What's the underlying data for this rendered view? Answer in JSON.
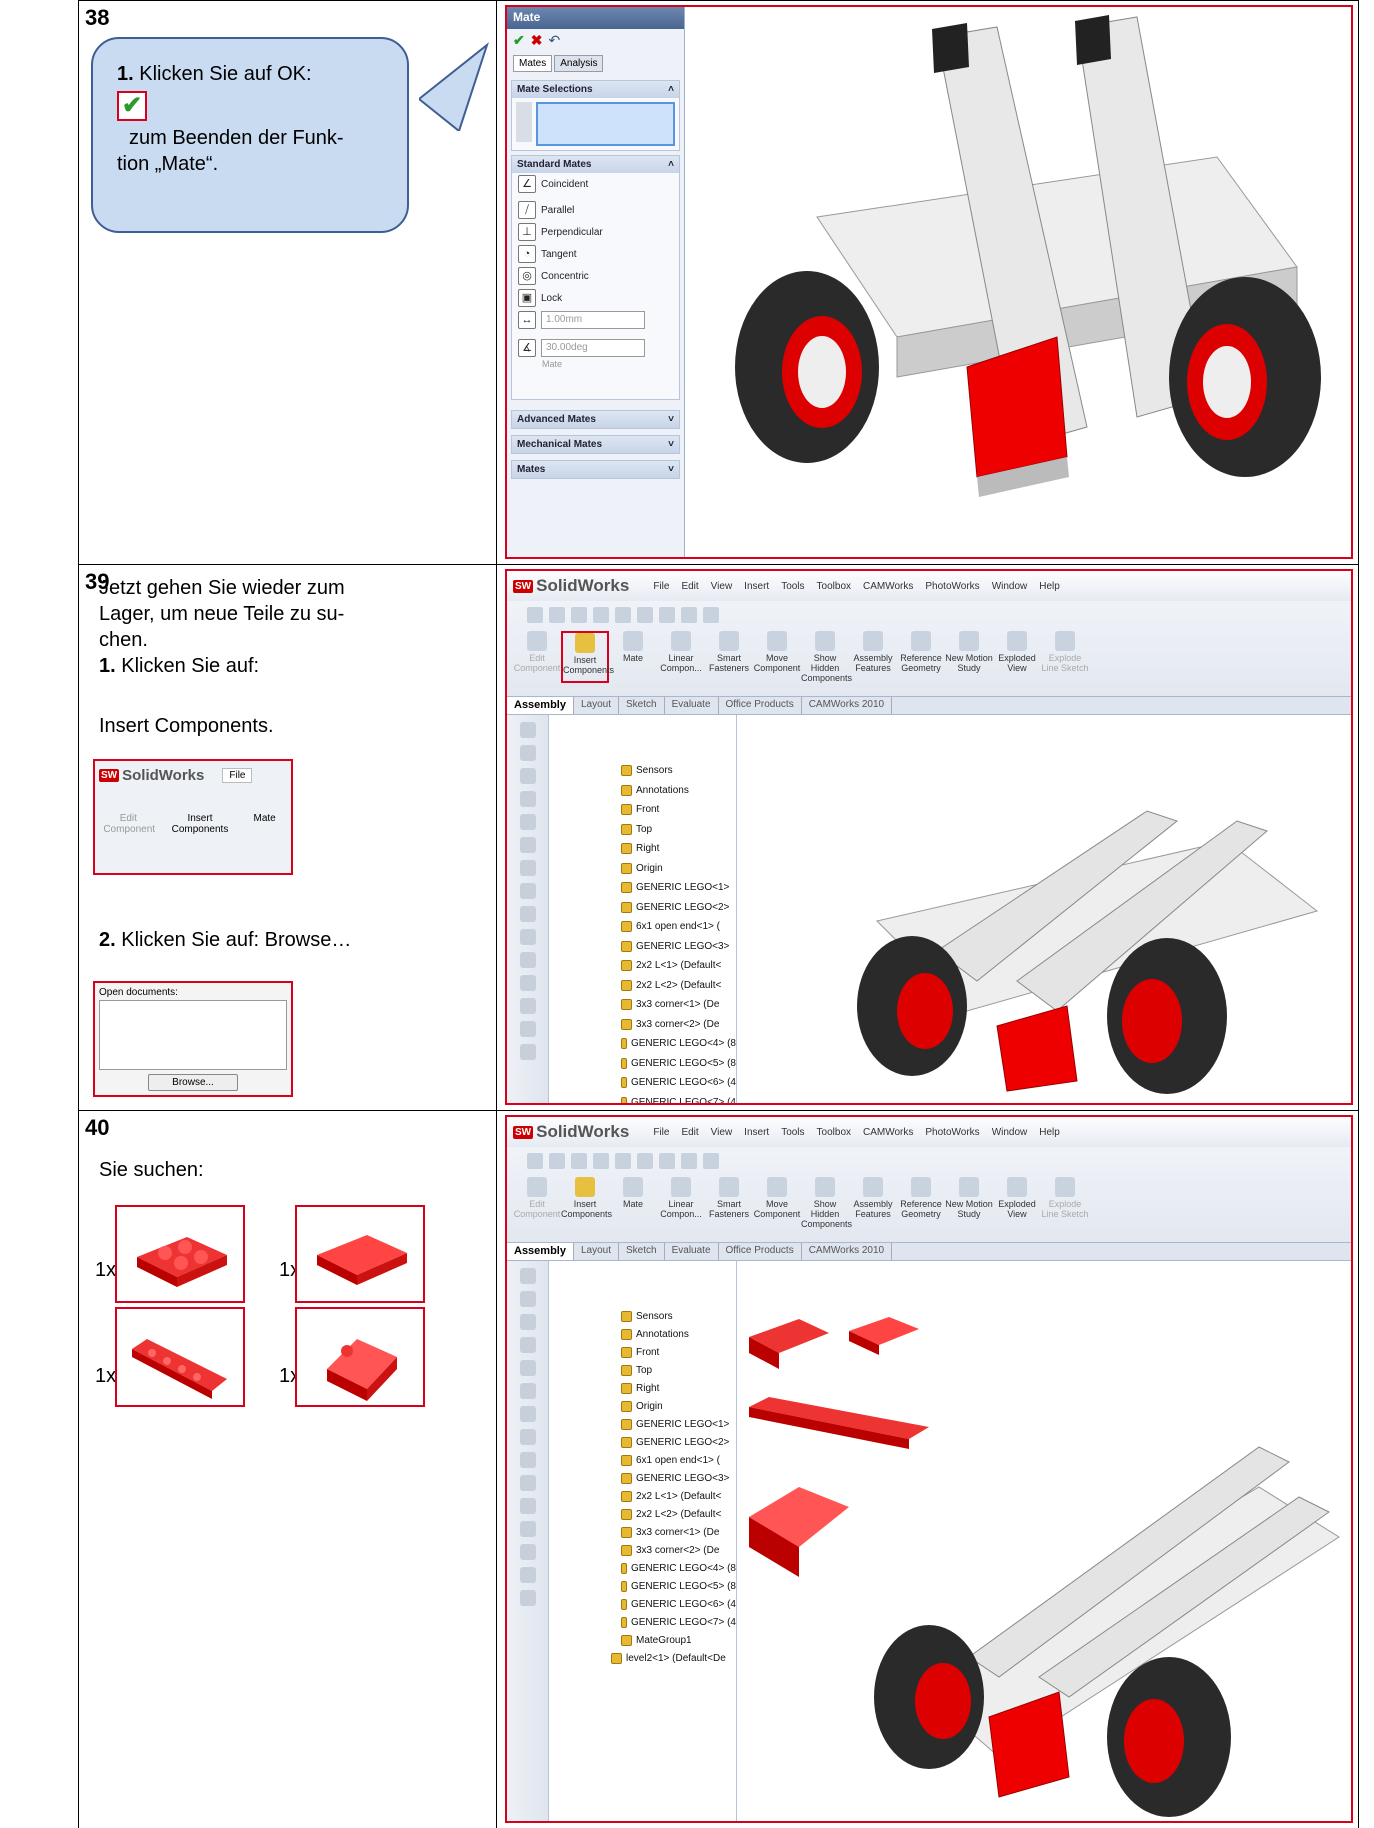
{
  "steps": [
    {
      "number": "38",
      "callout": {
        "lead": "1.",
        "line1": " Klicken Sie auf OK:",
        "line2": "zum Beenden der Funk-",
        "line3": "tion „Mate“."
      },
      "property_manager": {
        "title": "Mate",
        "tab_mates": "Mates",
        "tab_analysis": "Analysis",
        "section_selections": "Mate Selections",
        "section_standard": "Standard Mates",
        "mates": [
          "Coincident",
          "Parallel",
          "Perpendicular",
          "Tangent",
          "Concentric",
          "Lock"
        ],
        "distance": "1.00mm",
        "angle": "30.00deg",
        "mate_label": "Mate",
        "section_advanced": "Advanced Mates",
        "section_mechanical": "Mechanical Mates",
        "section_mates": "Mates"
      }
    },
    {
      "number": "39",
      "text1": "Jetzt gehen Sie wieder zum",
      "text2": "Lager, um neue Teile zu su-",
      "text3": "chen.",
      "lead1": "1.",
      "click1": " Klicken Sie auf:",
      "insert_components": "Insert Components.",
      "lead2": "2.",
      "click2": " Klicken Sie auf: Browse…",
      "mini_logo": "SolidWorks",
      "mini_file": "File",
      "mini_edit": "Edit Component",
      "mini_insert": "Insert Components",
      "mini_mate": "Mate",
      "open_documents": "Open documents:",
      "browse": "Browse..."
    },
    {
      "number": "40",
      "search_text": "Sie suchen:",
      "quantities": [
        "1x",
        "1x",
        "1x",
        "1x"
      ]
    }
  ],
  "solidworks": {
    "logo": "SolidWorks",
    "menu": [
      "File",
      "Edit",
      "View",
      "Insert",
      "Tools",
      "Toolbox",
      "CAMWorks",
      "PhotoWorks",
      "Window",
      "Help"
    ],
    "commands": [
      "Edit Component",
      "Insert Components",
      "Mate",
      "Linear Compon...",
      "Smart Fasteners",
      "Move Component",
      "Show Hidden Components",
      "Assembly Features",
      "Reference Geometry",
      "New Motion Study",
      "Exploded View",
      "Explode Line Sketch"
    ],
    "tabs": [
      "Assembly",
      "Layout",
      "Sketch",
      "Evaluate",
      "Office Products",
      "CAMWorks 2010"
    ],
    "tree": [
      "Sensors",
      "Annotations",
      "Front",
      "Top",
      "Right",
      "Origin",
      "GENERIC LEGO<1>",
      "GENERIC LEGO<2>",
      "6x1 open end<1> (",
      "GENERIC LEGO<3>",
      "2x2 L<1> (Default<",
      "2x2 L<2> (Default<",
      "3x3 corner<1> (De",
      "3x3 corner<2> (De",
      "GENERIC LEGO<4> (8",
      "GENERIC LEGO<5> (8",
      "GENERIC LEGO<6> (4",
      "GENERIC LEGO<7> (4",
      "MateGroup1",
      "level2<1> (Default<De"
    ]
  }
}
